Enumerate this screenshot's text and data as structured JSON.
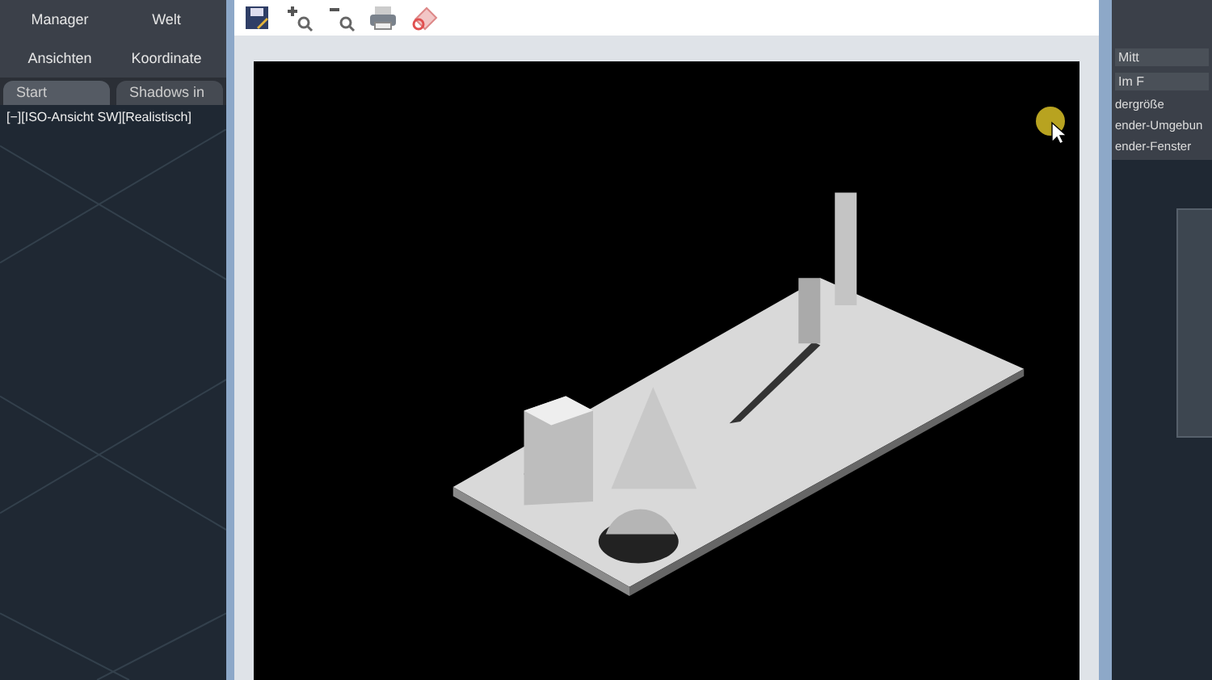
{
  "ribbon": {
    "labels": [
      "Manager",
      "Welt"
    ],
    "groups": [
      "Ansichten",
      "Koordinate"
    ]
  },
  "tabs": [
    {
      "label": "Start",
      "selected": true
    },
    {
      "label": "Shadows in",
      "selected": false
    }
  ],
  "viewport": {
    "label": "[−][ISO-Ansicht SW][Realistisch]"
  },
  "right_panel": {
    "buttons": [
      "Mitt",
      "Im F"
    ],
    "labels": [
      "dergröße",
      "ender-Umgebun",
      "ender-Fenster"
    ]
  }
}
